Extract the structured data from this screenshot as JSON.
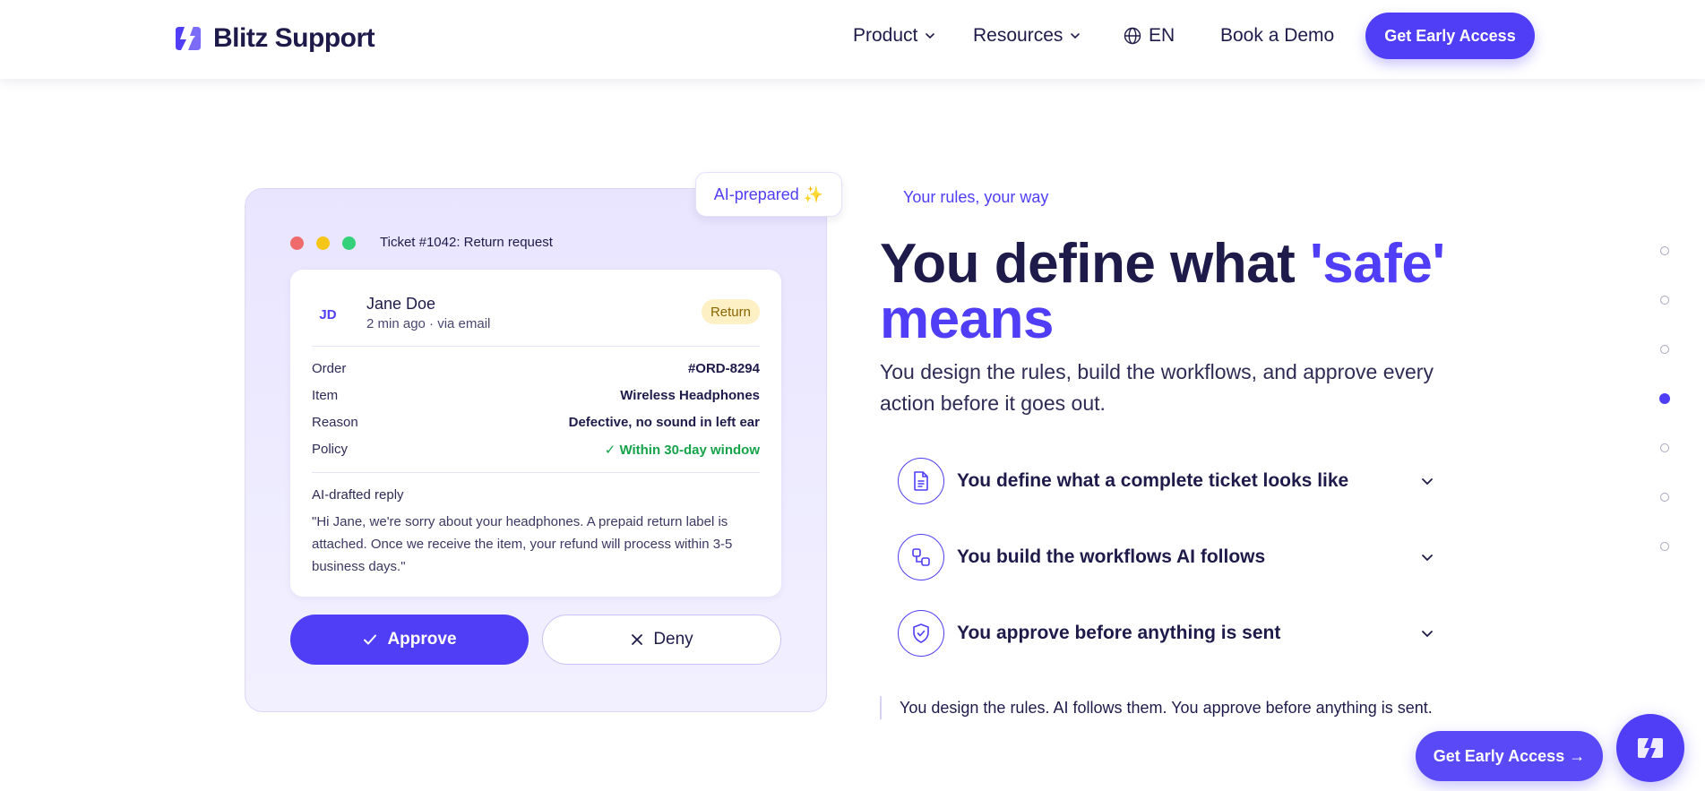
{
  "colors": {
    "brand": "#4f3ef5",
    "ink": "#1e1b4b",
    "success": "#16a34a",
    "badge_bg": "#fdf0c4",
    "window_red": "#ef6b6b",
    "window_yellow": "#f5c518",
    "window_green": "#34d17a"
  },
  "nav": {
    "brand_name": "Blitz Support",
    "product_label": "Product",
    "resources_label": "Resources",
    "language_label": "EN",
    "demo_label": "Book a Demo",
    "cta_label": "Get Early Access",
    "icons": [
      "logo-bolt-icon",
      "chevron-down-icon",
      "globe-icon"
    ]
  },
  "ticket_panel": {
    "ai_badge": "AI-prepared ✨",
    "window_title": "Ticket #1042: Return request",
    "customer": {
      "initials": "JD",
      "name": "Jane Doe",
      "meta": "2 min ago · via email",
      "tag": "Return"
    },
    "details": [
      {
        "label": "Order",
        "value": "#ORD-8294"
      },
      {
        "label": "Item",
        "value": "Wireless Headphones"
      },
      {
        "label": "Reason",
        "value": "Defective, no sound in left ear"
      },
      {
        "label": "Policy",
        "value": "✓ Within 30-day window"
      }
    ],
    "reply_label": "AI-drafted reply",
    "reply_text": "\"Hi Jane, we're sorry about your headphones. A prepaid return label is attached. Once we receive the item, your refund will process within 3-5 business days.\"",
    "approve_label": "Approve",
    "deny_label": "Deny"
  },
  "content": {
    "eyebrow": "Your rules, your way",
    "headline_main": "You define what ",
    "headline_accent": "'safe' means",
    "subcopy": "You design the rules, build the workflows, and approve every action before it goes out.",
    "accordion": [
      {
        "label": "You define what a complete ticket looks like",
        "icon": "document-icon"
      },
      {
        "label": "You build the workflows AI follows",
        "icon": "workflow-icon"
      },
      {
        "label": "You approve before anything is sent",
        "icon": "shield-check-icon"
      }
    ],
    "quote": "You design the rules. AI follows them. You approve before anything is sent."
  },
  "section_nav": {
    "count": 7,
    "active_index": 3
  },
  "floating": {
    "cta_label": "Get Early Access →",
    "chat_icon": "chat-bolt-icon"
  }
}
